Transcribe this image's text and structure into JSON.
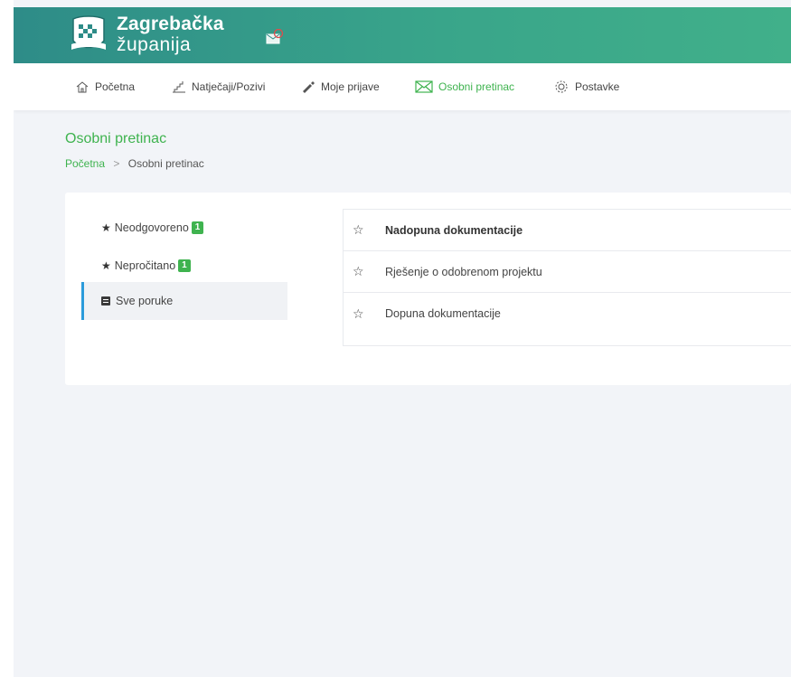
{
  "header": {
    "brand_line1": "Zagrebačka",
    "brand_line2": "županija",
    "colors": {
      "header_start": "#2e8c88",
      "header_end": "#41b08a",
      "accent_green": "#3fb34f",
      "active_marker": "#2b9bdb"
    }
  },
  "nav": {
    "items": [
      {
        "label": "Početna",
        "icon": "home-icon",
        "active": false
      },
      {
        "label": "Natječaji/Pozivi",
        "icon": "stairs-icon",
        "active": false
      },
      {
        "label": "Moje prijave",
        "icon": "edit-icon",
        "active": false
      },
      {
        "label": "Osobni pretinac",
        "icon": "envelope-icon",
        "active": true
      },
      {
        "label": "Postavke",
        "icon": "gear-icon",
        "active": false
      }
    ]
  },
  "page": {
    "title": "Osobni pretinac",
    "breadcrumb": {
      "home": "Početna",
      "separator": ">",
      "current": "Osobni pretinac"
    }
  },
  "sidebar": {
    "items": [
      {
        "label": "Neodgovoreno",
        "badge": "1",
        "icon": "star-icon"
      },
      {
        "label": "Nepročitano",
        "badge": "1",
        "icon": "star-icon"
      },
      {
        "label": "Sve poruke",
        "icon": "document-icon",
        "active": true
      }
    ]
  },
  "messages": [
    {
      "subject": "Nadopuna dokumentacije",
      "unread": true
    },
    {
      "subject": "Rješenje o odobrenom projektu",
      "unread": false
    },
    {
      "subject": "Dopuna dokumentacije",
      "unread": false
    }
  ]
}
